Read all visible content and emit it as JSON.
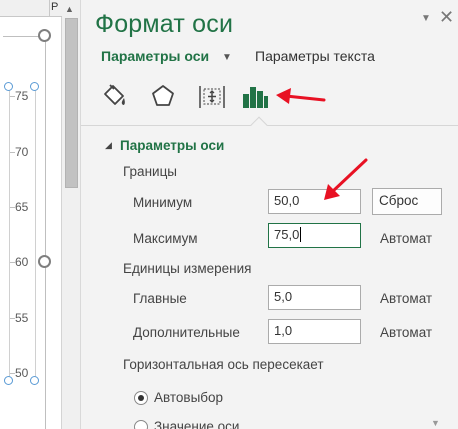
{
  "sheet": {
    "column_header": "P",
    "axis_ticks": [
      "75",
      "70",
      "65",
      "60",
      "55",
      "50"
    ]
  },
  "pane": {
    "title": "Формат оси",
    "tabs": {
      "axis_options": "Параметры оси",
      "text_options": "Параметры текста"
    },
    "icons": [
      "fill-line-icon",
      "effects-icon",
      "size-properties-icon",
      "axis-options-icon"
    ],
    "section_title": "Параметры оси",
    "bounds": {
      "label": "Границы",
      "minimum_label": "Минимум",
      "minimum_value": "50,0",
      "reset_label": "Сброс",
      "maximum_label": "Максимум",
      "maximum_value": "75,0",
      "maximum_mode": "Автомат"
    },
    "units": {
      "label": "Единицы измерения",
      "major_label": "Главные",
      "major_value": "5,0",
      "major_mode": "Автомат",
      "minor_label": "Дополнительные",
      "minor_value": "1,0",
      "minor_mode": "Автомат"
    },
    "crosses": {
      "label": "Горизонтальная ось пересекает",
      "auto_label": "Автовыбор",
      "value_label": "Значение оси",
      "auto_checked": true
    }
  },
  "colors": {
    "accent": "#217346",
    "annotation": "#e81123",
    "handle": "#5b9bd5"
  }
}
